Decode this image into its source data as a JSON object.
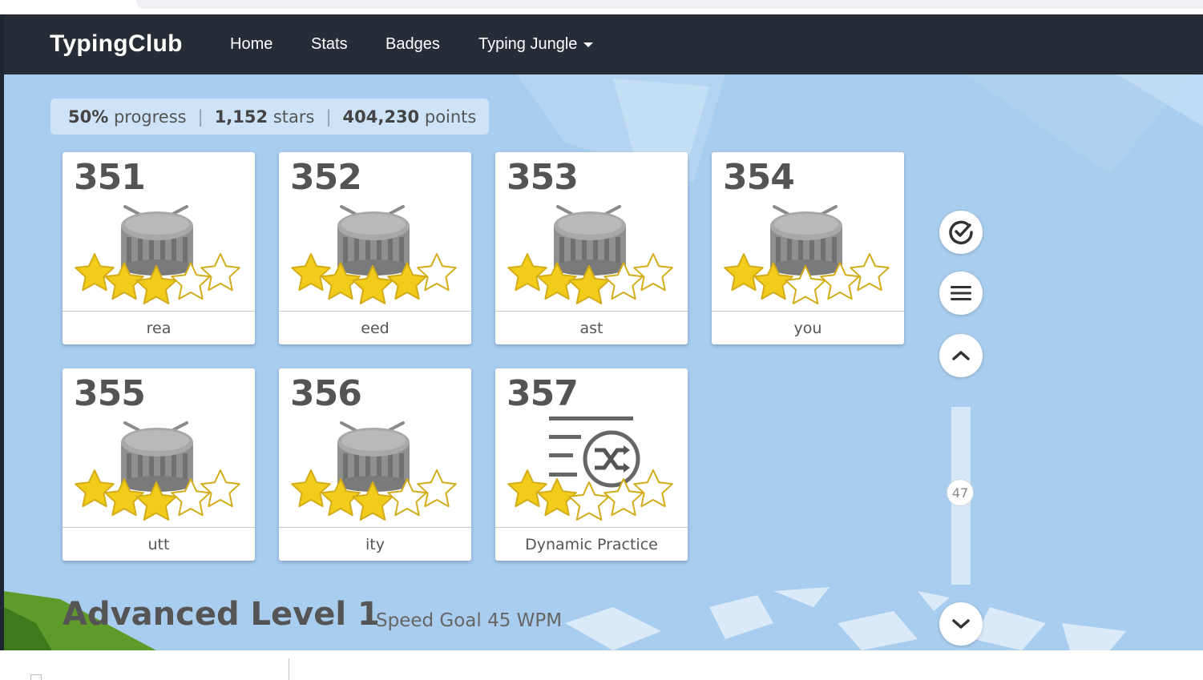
{
  "navbar": {
    "brand": "TypingClub",
    "items": [
      {
        "label": "Home"
      },
      {
        "label": "Stats"
      },
      {
        "label": "Badges"
      },
      {
        "label": "Typing Jungle",
        "has_dropdown": true
      }
    ]
  },
  "summary": {
    "progress_value": "50%",
    "progress_label": "progress",
    "stars_value": "1,152",
    "stars_label": "stars",
    "points_value": "404,230",
    "points_label": "points",
    "separator": "|"
  },
  "lessons": [
    {
      "number": "351",
      "title": "rea",
      "icon": "drum-icon",
      "stars": 3,
      "max_stars": 5
    },
    {
      "number": "352",
      "title": "eed",
      "icon": "drum-icon",
      "stars": 4,
      "max_stars": 5
    },
    {
      "number": "353",
      "title": "ast",
      "icon": "drum-icon",
      "stars": 3,
      "max_stars": 5
    },
    {
      "number": "354",
      "title": "you",
      "icon": "drum-icon",
      "stars": 2,
      "max_stars": 5
    },
    {
      "number": "355",
      "title": "utt",
      "icon": "drum-icon",
      "stars": 3,
      "max_stars": 5
    },
    {
      "number": "356",
      "title": "ity",
      "icon": "drum-icon",
      "stars": 3,
      "max_stars": 5
    },
    {
      "number": "357",
      "title": "Dynamic Practice",
      "icon": "shuffle-list-icon",
      "stars": 2,
      "max_stars": 5
    }
  ],
  "sidebar": {
    "buttons": [
      {
        "icon": "check-circle-icon"
      },
      {
        "icon": "menu-icon"
      },
      {
        "icon": "chevron-up-icon"
      },
      {
        "icon": "chevron-down-icon"
      }
    ],
    "scroll_indicator": "47"
  },
  "level": {
    "title": "Advanced Level 1",
    "subtitle": "Speed Goal 45 WPM"
  },
  "colors": {
    "navbar_bg": "#262d36",
    "page_bg": "#a9cdee",
    "star_gold": "#f2cc1a",
    "star_outline": "#d3ac19",
    "drum_gray": "#9b9b9b"
  }
}
